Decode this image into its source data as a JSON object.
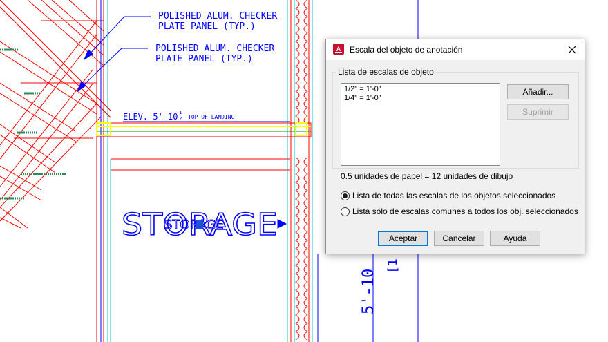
{
  "drawing": {
    "notes": [
      {
        "line1": "POLISHED ALUM. CHECKER",
        "line2": "PLATE PANEL (TYP.)"
      },
      {
        "line1": "POLISHED ALUM. CHECKER",
        "line2": "PLATE PANEL (TYP.)"
      }
    ],
    "elevation": {
      "main": "ELEV. 5'-10",
      "fraction_num": "1",
      "fraction_den": "2",
      "suffix": "TOP OF LANDING"
    },
    "room_label": "STORAGE",
    "room_label_small": "STORAGE",
    "vertical_dim": "5'-10",
    "vertical_dim_2": "[1",
    "colors": {
      "cad_blue": "#0000ff",
      "cad_red": "#ff0000",
      "cad_cyan": "#00cccc",
      "cad_yellow": "#ffff00",
      "cad_green": "#00a000"
    }
  },
  "dialog": {
    "title": "Escala del objeto de anotación",
    "app_icon": "autocad-app-icon",
    "close_icon": "close-icon",
    "group_label": "Lista de escalas de objeto",
    "scales": [
      "1/2\" = 1'-0\"",
      "1/4\" = 1'-0\""
    ],
    "buttons": {
      "add": "Añadir...",
      "remove": "Suprimir",
      "ok": "Aceptar",
      "cancel": "Cancelar",
      "help": "Ayuda"
    },
    "ratio_text": "0.5 unidades de papel = 12 unidades de dibujo",
    "radio_all": "Lista de todas las escalas de los objetos seleccionados",
    "radio_common": "Lista sólo de escalas comunes a todos los obj. seleccionados",
    "radio_selected": "all"
  }
}
